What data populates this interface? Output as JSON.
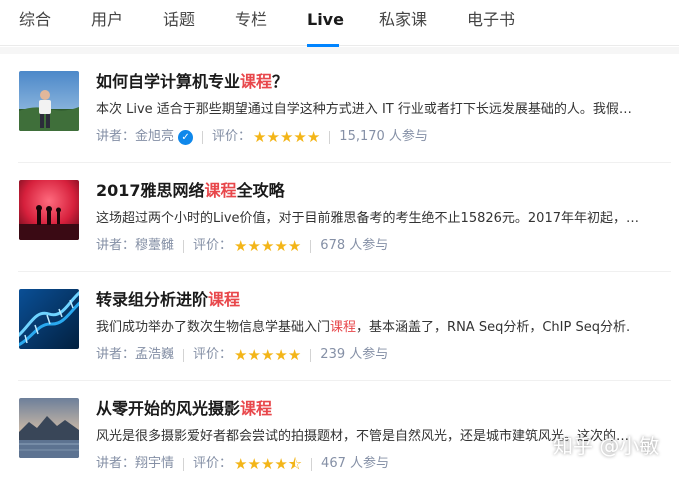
{
  "tabs": [
    {
      "label": "综合",
      "active": false
    },
    {
      "label": "用户",
      "active": false
    },
    {
      "label": "话题",
      "active": false
    },
    {
      "label": "专栏",
      "active": false
    },
    {
      "label": "Live",
      "active": true
    },
    {
      "label": "私家课",
      "active": false
    },
    {
      "label": "电子书",
      "active": false
    }
  ],
  "colors": {
    "accent": "#0084ff",
    "highlight": "#e8474b",
    "star": "#f3b518",
    "meta": "#8590a6"
  },
  "lives": [
    {
      "title_pre": "如何自学计算机专业",
      "title_hl": "课程",
      "title_post": "？",
      "desc_pre": "本次 Live 适合于那些期望通过自学这种方式进入 IT 行业或者打下长远发展基础的人。我假…",
      "desc_hl": "",
      "desc_post": "",
      "speaker_label": "讲者：",
      "speaker": "金旭亮",
      "verified": true,
      "rating_label": "评价：",
      "rating": 5,
      "stars": "★★★★★",
      "participants": "15,170 人参与"
    },
    {
      "title_pre": "2017雅思网络",
      "title_hl": "课程",
      "title_post": "全攻略",
      "desc_pre": "这场超过两个小时的Live价值，对于目前雅思备考的考生绝不止15826元。2017年年初起，…",
      "desc_hl": "",
      "desc_post": "",
      "speaker_label": "讲者：",
      "speaker": "穆薹雠",
      "verified": false,
      "rating_label": "评价：",
      "rating": 5,
      "stars": "★★★★★",
      "participants": "678 人参与"
    },
    {
      "title_pre": "转录组分析进阶",
      "title_hl": "课程",
      "title_post": "",
      "desc_pre": "我们成功举办了数次生物信息学基础入门",
      "desc_hl": "课程",
      "desc_post": "，基本涵盖了，RNA Seq分析，ChIP Seq分析.",
      "speaker_label": "讲者：",
      "speaker": "孟浩巍",
      "verified": false,
      "rating_label": "评价：",
      "rating": 5,
      "stars": "★★★★★",
      "participants": "239 人参与"
    },
    {
      "title_pre": "从零开始的风光摄影",
      "title_hl": "课程",
      "title_post": "",
      "desc_pre": "风光是很多摄影爱好者都会尝试的拍摄题材，不管是自然风光，还是城市建筑风光。这次的…",
      "desc_hl": "",
      "desc_post": "",
      "speaker_label": "讲者：",
      "speaker": "翔宇情",
      "verified": false,
      "rating_label": "评价：",
      "rating": 4.5,
      "stars": "★★★★⯪",
      "participants": "467 人参与"
    }
  ],
  "watermark": "知乎 @小敏"
}
